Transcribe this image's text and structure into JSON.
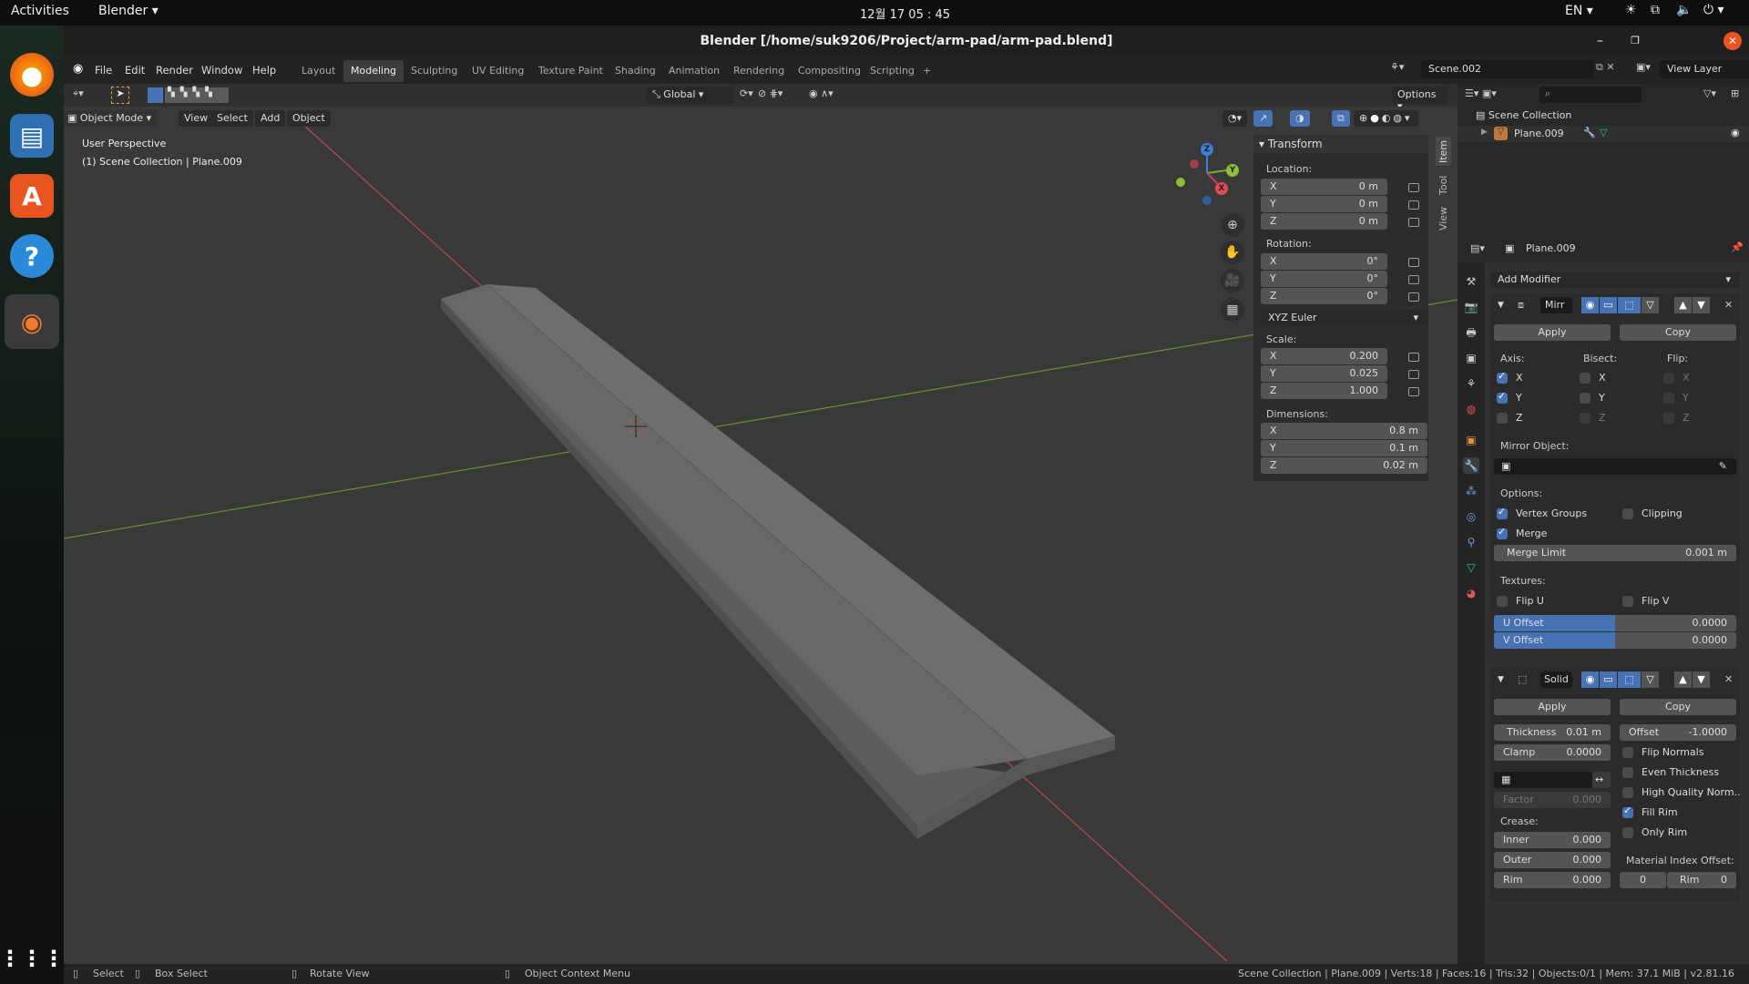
{
  "system": {
    "activities": "Activities",
    "app_menu": "Blender",
    "clock": "12월 17  05 : 45",
    "language": "EN"
  },
  "window": {
    "title": "Blender [/home/suk9206/Project/arm-pad/arm-pad.blend]"
  },
  "menu": [
    "File",
    "Edit",
    "Render",
    "Window",
    "Help"
  ],
  "workspaces": [
    "Layout",
    "Modeling",
    "Sculpting",
    "UV Editing",
    "Texture Paint",
    "Shading",
    "Animation",
    "Rendering",
    "Compositing",
    "Scripting"
  ],
  "active_workspace": "Modeling",
  "scene": {
    "name": "Scene.002",
    "view_layer": "View Layer"
  },
  "toolheader": {
    "orientation": "Global",
    "options": "Options"
  },
  "viewport_header": {
    "mode": "Object Mode",
    "items": [
      "View",
      "Select",
      "Add",
      "Object"
    ]
  },
  "viewport": {
    "perspective": "User Perspective",
    "context": "(1) Scene Collection | Plane.009",
    "axis_colors": {
      "x": "#c8404f",
      "y": "#7fa82f",
      "z": "#3b7fd9"
    }
  },
  "npanel": {
    "tabs": [
      "Item",
      "Tool",
      "View"
    ],
    "title": "Transform",
    "location": {
      "label": "Location:",
      "x": "0 m",
      "y": "0 m",
      "z": "0 m"
    },
    "rotation": {
      "label": "Rotation:",
      "x": "0°",
      "y": "0°",
      "z": "0°"
    },
    "rotation_mode": "XYZ Euler",
    "scale": {
      "label": "Scale:",
      "x": "0.200",
      "y": "0.025",
      "z": "1.000"
    },
    "dimensions": {
      "label": "Dimensions:",
      "x": "0.8 m",
      "y": "0.1 m",
      "z": "0.02 m"
    },
    "axes": [
      "X",
      "Y",
      "Z"
    ]
  },
  "outliner": {
    "root": "Scene Collection",
    "items": [
      {
        "name": "Plane.009"
      }
    ]
  },
  "properties": {
    "object": "Plane.009",
    "add_modifier": "Add Modifier",
    "mirror": {
      "name": "Mirr",
      "apply": "Apply",
      "copy": "Copy",
      "axis_label": "Axis:",
      "bisect_label": "Bisect:",
      "flip_label": "Flip:",
      "axis": {
        "x": true,
        "y": true,
        "z": false
      },
      "bisect": {
        "x": false,
        "y": false,
        "z": false
      },
      "flip": {
        "x": false,
        "y": false,
        "z": false
      },
      "mirror_object_label": "Mirror Object:",
      "options_label": "Options:",
      "vertex_groups": {
        "label": "Vertex Groups",
        "checked": true
      },
      "clipping": {
        "label": "Clipping",
        "checked": false
      },
      "merge": {
        "label": "Merge",
        "checked": true
      },
      "merge_limit": {
        "label": "Merge Limit",
        "value": "0.001 m"
      },
      "textures_label": "Textures:",
      "flip_u": {
        "label": "Flip U",
        "checked": false
      },
      "flip_v": {
        "label": "Flip V",
        "checked": false
      },
      "u_offset": {
        "label": "U Offset",
        "value": "0.0000"
      },
      "v_offset": {
        "label": "V Offset",
        "value": "0.0000"
      }
    },
    "solidify": {
      "name": "Solid",
      "apply": "Apply",
      "copy": "Copy",
      "thickness": {
        "label": "Thickness",
        "value": "0.01 m"
      },
      "offset": {
        "label": "Offset",
        "value": "-1.0000"
      },
      "clamp": {
        "label": "Clamp",
        "value": "0.0000"
      },
      "factor": {
        "label": "Factor",
        "value": "0.000"
      },
      "crease_label": "Crease:",
      "inner": {
        "label": "Inner",
        "value": "0.000"
      },
      "outer": {
        "label": "Outer",
        "value": "0.000"
      },
      "rim": {
        "label": "Rim",
        "value": "0.000"
      },
      "flip_normals": {
        "label": "Flip Normals",
        "checked": false
      },
      "even_thickness": {
        "label": "Even Thickness",
        "checked": false
      },
      "high_quality": {
        "label": "High Quality Norm..",
        "checked": false
      },
      "fill_rim": {
        "label": "Fill Rim",
        "checked": true
      },
      "only_rim": {
        "label": "Only Rim",
        "checked": false
      },
      "material_offset_label": "Material Index Offset:",
      "material_offset": "0",
      "material_rim_label": "Rim",
      "material_rim": "0"
    }
  },
  "statusbar": {
    "select": "Select",
    "box_select": "Box Select",
    "rotate": "Rotate View",
    "context_menu": "Object Context Menu",
    "stats": "Scene Collection | Plane.009 | Verts:18 | Faces:16 | Tris:32 | Objects:0/1 | Mem: 37.1 MiB | v2.81.16"
  }
}
